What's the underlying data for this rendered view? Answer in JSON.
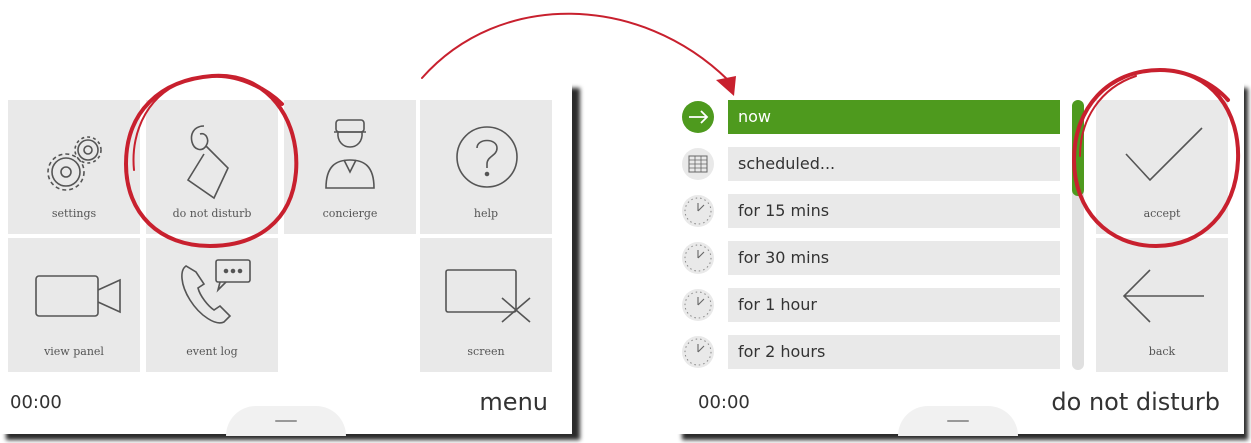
{
  "left_screen": {
    "tiles": [
      {
        "label": "settings",
        "icon": "gears-icon"
      },
      {
        "label": "do not disturb",
        "icon": "door-hanger-icon"
      },
      {
        "label": "concierge",
        "icon": "concierge-icon"
      },
      {
        "label": "help",
        "icon": "help-icon"
      },
      {
        "label": "view panel",
        "icon": "video-camera-icon"
      },
      {
        "label": "event log",
        "icon": "phone-message-icon"
      },
      {
        "label": "screen",
        "icon": "screen-off-icon"
      }
    ],
    "time": "00:00",
    "title": "menu"
  },
  "right_screen": {
    "options": [
      {
        "label": "now",
        "icon": "arrow-right-icon",
        "selected": true
      },
      {
        "label": "scheduled...",
        "icon": "calendar-icon",
        "selected": false
      },
      {
        "label": "for 15 mins",
        "icon": "clock-icon",
        "selected": false
      },
      {
        "label": "for 30 mins",
        "icon": "clock-icon",
        "selected": false
      },
      {
        "label": "for 1 hour",
        "icon": "clock-icon",
        "selected": false
      },
      {
        "label": "for 2 hours",
        "icon": "clock-icon",
        "selected": false
      }
    ],
    "accept_label": "accept",
    "back_label": "back",
    "time": "00:00",
    "title": "do not disturb"
  },
  "colors": {
    "accent_green": "#4e9a1e",
    "highlight_red": "#c8202e",
    "tile_bg": "#e9e9e9"
  }
}
